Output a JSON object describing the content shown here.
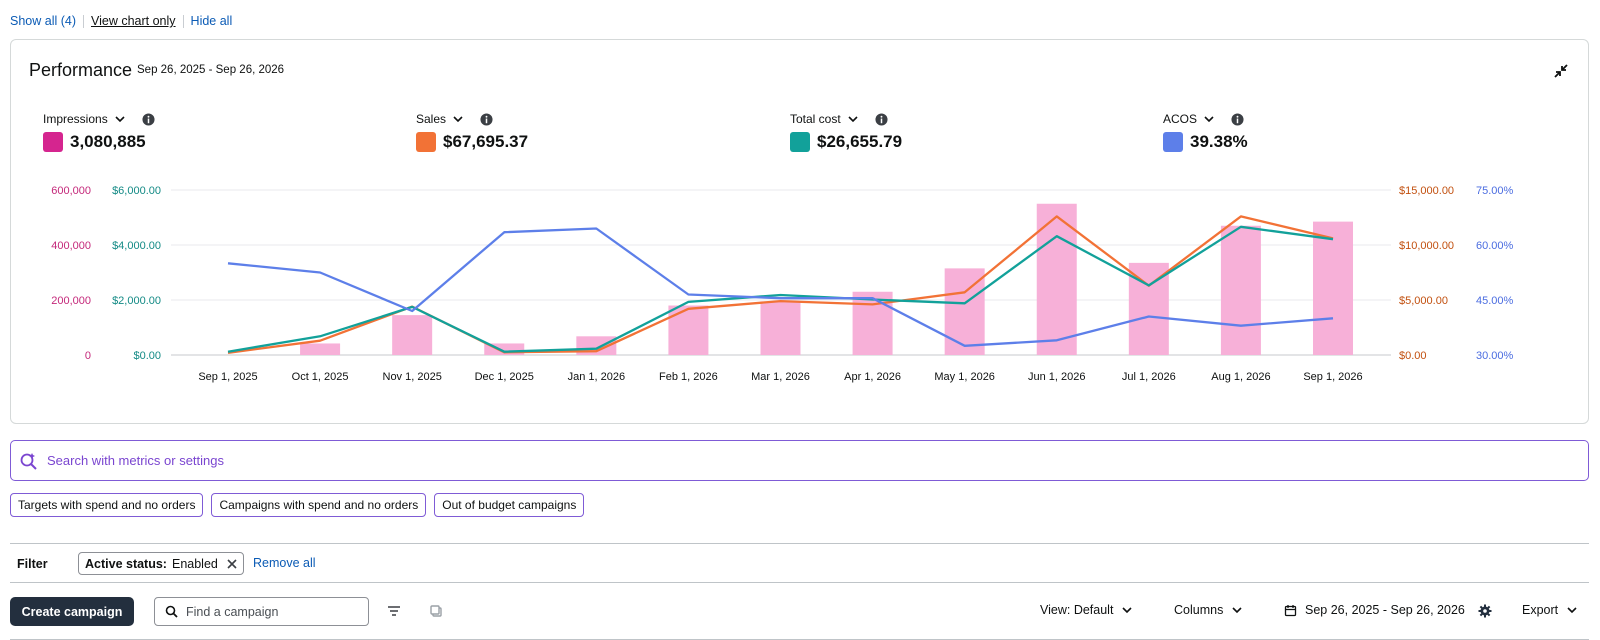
{
  "top_links": {
    "show_all": "Show all (4)",
    "view_chart_only": "View chart only",
    "hide_all": "Hide all"
  },
  "card": {
    "title": "Performance",
    "date_range": "Sep 26, 2025 - Sep 26, 2026",
    "collapse_icon": "collapse-arrows-icon"
  },
  "metrics": [
    {
      "label": "Impressions",
      "value": "3,080,885",
      "color": "#d5258f"
    },
    {
      "label": "Sales",
      "value": "$67,695.37",
      "color": "#f27236"
    },
    {
      "label": "Total cost",
      "value": "$26,655.79",
      "color": "#12a19a"
    },
    {
      "label": "ACOS",
      "value": "39.38%",
      "color": "#5d7fe9"
    }
  ],
  "chart_data": {
    "type": "bar",
    "categories": [
      "Sep 1, 2025",
      "Oct 1, 2025",
      "Nov 1, 2025",
      "Dec 1, 2025",
      "Jan 1, 2026",
      "Feb 1, 2026",
      "Mar 1, 2026",
      "Apr 1, 2026",
      "May 1, 2026",
      "Jun 1, 2026",
      "Jul 1, 2026",
      "Aug 1, 2026",
      "Sep 1, 2026"
    ],
    "series": [
      {
        "name": "Impressions",
        "type": "bar",
        "axis": "impressions",
        "color": "#f7b0d8",
        "values": [
          0,
          42000,
          145000,
          42000,
          68000,
          180000,
          195000,
          230000,
          315000,
          550000,
          335000,
          470000,
          485000
        ]
      },
      {
        "name": "Sales",
        "type": "line",
        "axis": "sales",
        "color": "#f27236",
        "values": [
          200,
          1300,
          4400,
          250,
          350,
          4200,
          4900,
          4600,
          5700,
          12600,
          6300,
          12600,
          10600
        ]
      },
      {
        "name": "Total cost",
        "type": "line",
        "axis": "cost",
        "color": "#12a19a",
        "values": [
          120,
          680,
          1750,
          120,
          230,
          1930,
          2180,
          2020,
          1880,
          4320,
          2530,
          4660,
          4210
        ]
      },
      {
        "name": "ACOS",
        "type": "line",
        "axis": "acos",
        "color": "#5d7fe9",
        "values": [
          55,
          52.5,
          42,
          63.5,
          64.5,
          46.5,
          45.5,
          45.5,
          32.5,
          34,
          40.5,
          38,
          40
        ]
      }
    ],
    "axes": {
      "impressions": {
        "range": [
          0,
          600000
        ],
        "ticks": [
          "0",
          "200,000",
          "400,000",
          "600,000"
        ],
        "color": "#c4287a"
      },
      "cost": {
        "range": [
          0,
          6000
        ],
        "ticks": [
          "$0.00",
          "$2,000.00",
          "$4,000.00",
          "$6,000.00"
        ],
        "color": "#138a85"
      },
      "sales": {
        "range": [
          0,
          15000
        ],
        "ticks": [
          "$0.00",
          "$5,000.00",
          "$10,000.00",
          "$15,000.00"
        ],
        "color": "#c2500f"
      },
      "acos": {
        "range": [
          30,
          75
        ],
        "ticks": [
          "30.00%",
          "45.00%",
          "60.00%",
          "75.00%"
        ],
        "color": "#4a6ce0"
      }
    },
    "grid": true
  },
  "search": {
    "placeholder": "Search with metrics or settings"
  },
  "chips": [
    "Targets with spend and no orders",
    "Campaigns with spend and no orders",
    "Out of budget campaigns"
  ],
  "filter": {
    "label": "Filter",
    "status_key": "Active status:",
    "status_value": "Enabled",
    "remove_all": "Remove all"
  },
  "toolbar": {
    "create": "Create campaign",
    "find_placeholder": "Find a campaign",
    "view": "View: Default",
    "columns": "Columns",
    "date_range": "Sep 26, 2025 - Sep 26, 2026",
    "export": "Export"
  }
}
